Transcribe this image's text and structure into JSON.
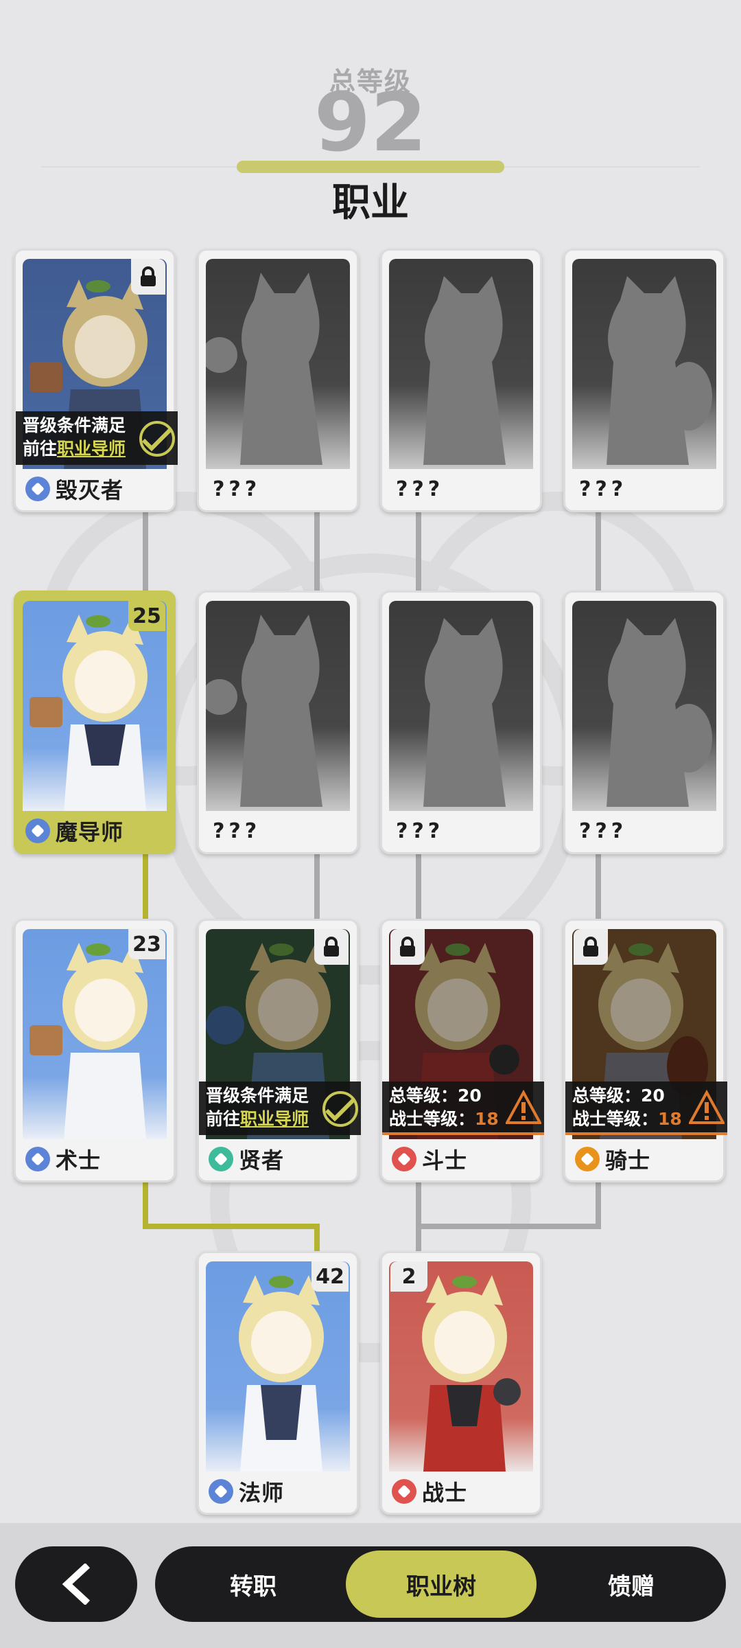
{
  "header": {
    "total_level_label": "总等级",
    "total_level_value": "92",
    "title": "职业"
  },
  "cards": {
    "destroyer": {
      "name": "毁灭者",
      "banner_line1": "晋级条件满足",
      "banner_prefix": "前往",
      "banner_link": "职业导师"
    },
    "unknown_1": {
      "name": "???"
    },
    "unknown_2": {
      "name": "???"
    },
    "unknown_3": {
      "name": "???"
    },
    "magister": {
      "name": "魔导师",
      "level": "25"
    },
    "unknown_4": {
      "name": "???"
    },
    "unknown_5": {
      "name": "???"
    },
    "unknown_6": {
      "name": "???"
    },
    "warlock": {
      "name": "术士",
      "level": "23"
    },
    "sage": {
      "name": "贤者",
      "banner_line1": "晋级条件满足",
      "banner_prefix": "前往",
      "banner_link": "职业导师"
    },
    "brawler": {
      "name": "斗士",
      "req_total_label": "总等级：",
      "req_total_value": "20",
      "req_class_label": "战士等级：",
      "req_class_value": "18"
    },
    "knight": {
      "name": "骑士",
      "req_total_label": "总等级：",
      "req_total_value": "20",
      "req_class_label": "战士等级：",
      "req_class_value": "18"
    },
    "mage": {
      "name": "法师",
      "level": "42"
    },
    "warrior": {
      "name": "战士",
      "level": "2"
    }
  },
  "bottom_nav": {
    "back_icon": "chevron-left-icon",
    "tabs": [
      {
        "label": "转职",
        "selected": false
      },
      {
        "label": "职业树",
        "selected": true
      },
      {
        "label": "馈赠",
        "selected": false
      }
    ]
  },
  "colors": {
    "accent": "#c8c856",
    "warning": "#e07a2c",
    "background": "#e6e6e8",
    "dark": "#1c1c1e"
  }
}
